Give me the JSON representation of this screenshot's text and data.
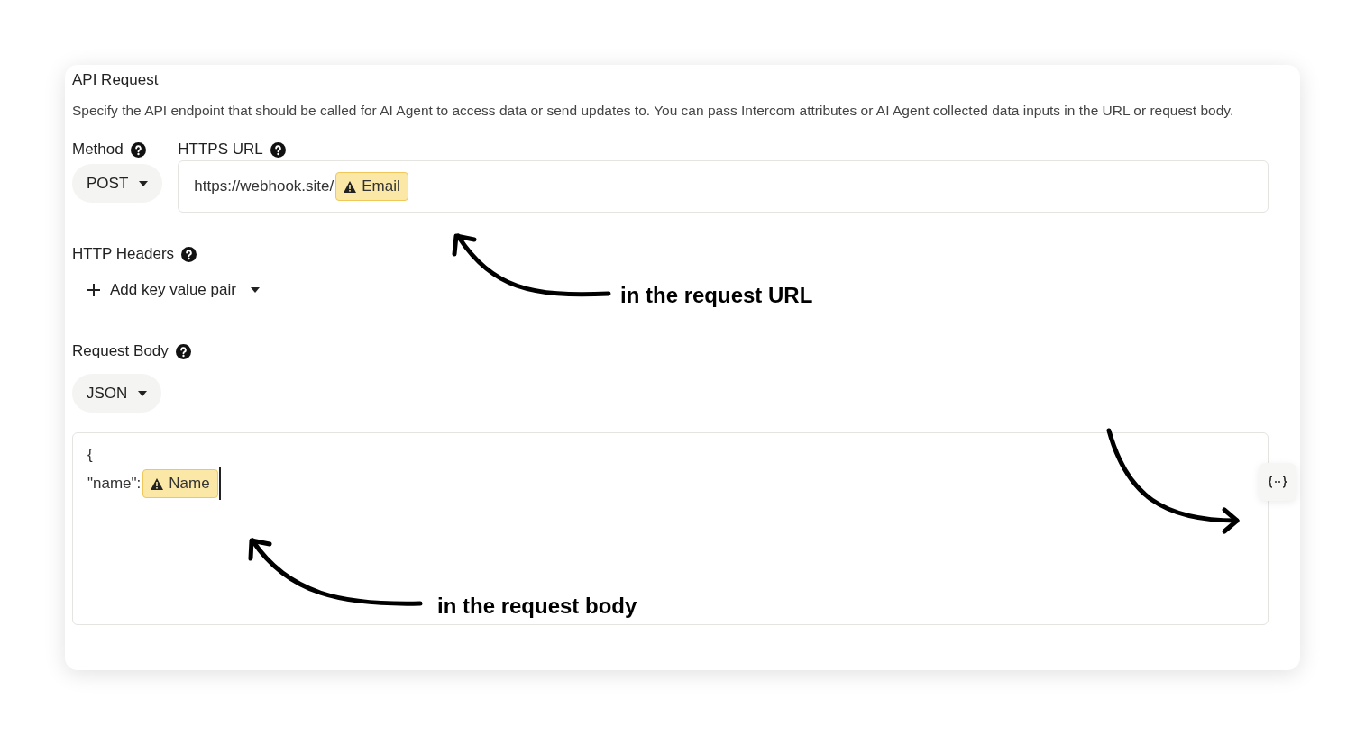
{
  "section": {
    "title": "API Request",
    "description": "Specify the API endpoint that should be called for AI Agent to access data or send updates to. You can pass Intercom attributes or AI Agent collected data inputs in the URL or request body."
  },
  "method": {
    "label": "Method",
    "value": "POST"
  },
  "url": {
    "label": "HTTPS URL",
    "prefix": "https://webhook.site/",
    "attribute": "Email"
  },
  "headers": {
    "label": "HTTP Headers",
    "add_button": "Add key value pair"
  },
  "body": {
    "label": "Request Body",
    "format": "JSON",
    "lines": [
      "{",
      "\"name\":"
    ],
    "attribute": "Name"
  },
  "annotations": [
    "in the request URL",
    "in the request body"
  ]
}
